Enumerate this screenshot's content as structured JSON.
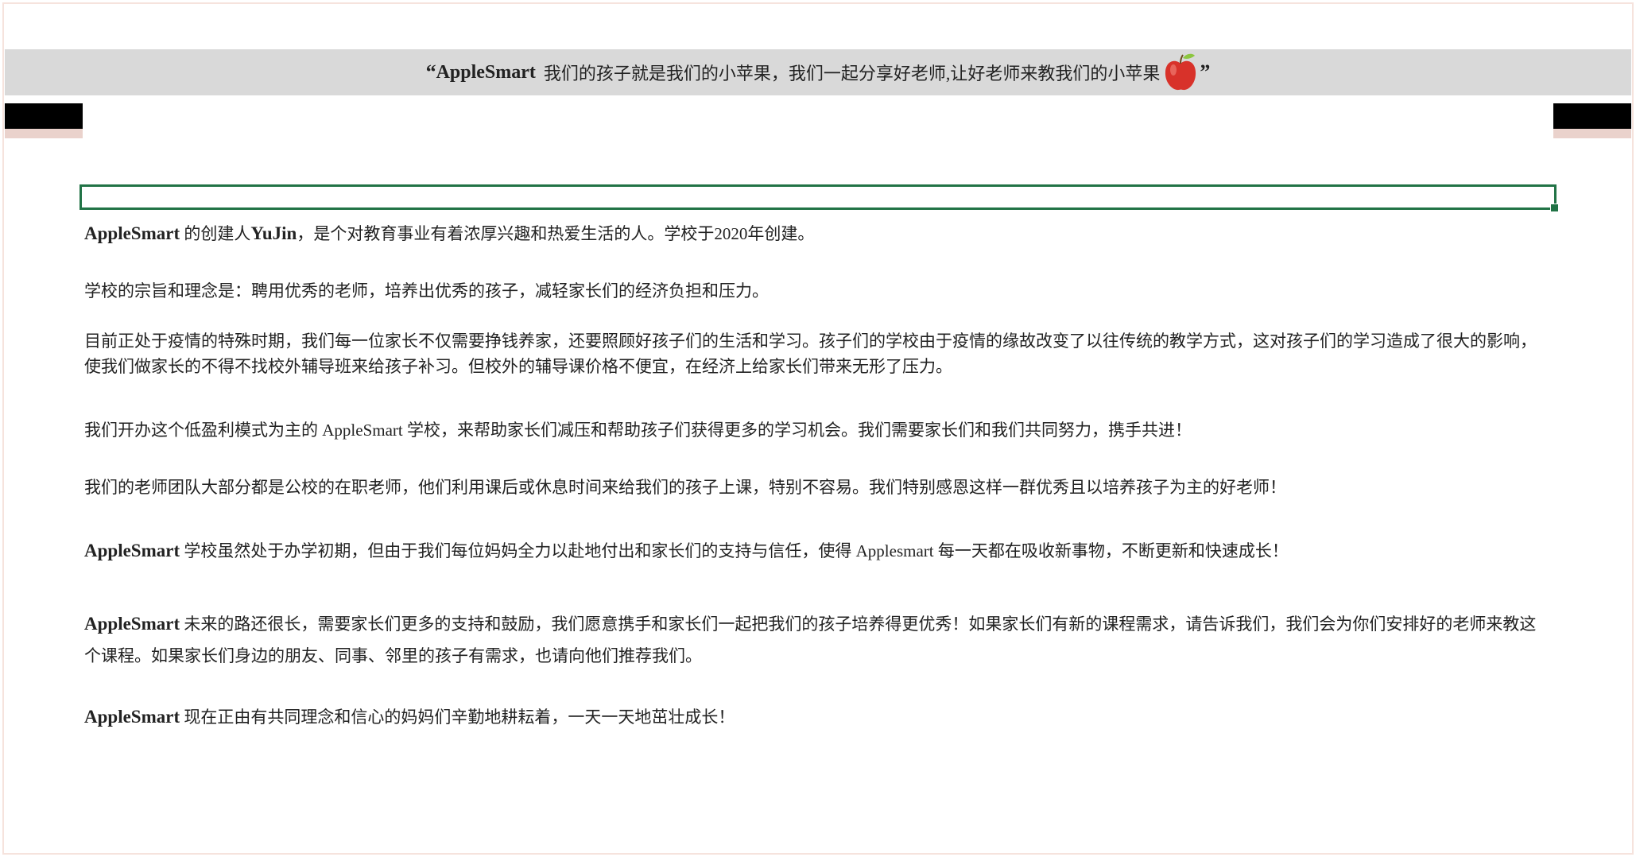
{
  "banner": {
    "open_quote": "“",
    "brand": "AppleSmart",
    "slogan": "我们的孩子就是我们的小苹果，我们一起分享好老师,让好老师来教我们的小苹果",
    "close_quote": "”",
    "icon": "apple-icon"
  },
  "colors": {
    "banner_bg": "#d9d9d9",
    "selection_border": "#217346",
    "corner_block": "#000000",
    "corner_accent": "#ead2cc"
  },
  "paragraphs": [
    {
      "bold": "AppleSmart",
      "text": " 的创建人",
      "bold2": "YuJin",
      "text2": "，是个对教育事业有着浓厚兴趣和热爱生活的人。学校于2020年创建。"
    },
    {
      "text": "学校的宗旨和理念是：聘用优秀的老师，培养出优秀的孩子，减轻家长们的经济负担和压力。"
    },
    {
      "text": "目前正处于疫情的特殊时期，我们每一位家长不仅需要挣钱养家，还要照顾好孩子们的生活和学习。孩子们的学校由于疫情的缘故改变了以往传统的教学方式，这对孩子们的学习造成了很大的影响，使我们做家长的不得不找校外辅导班来给孩子补习。但校外的辅导课价格不便宜，在经济上给家长们带来无形了压力。"
    },
    {
      "text": "我们开办这个低盈利模式为主的 AppleSmart 学校，来帮助家长们减压和帮助孩子们获得更多的学习机会。我们需要家长们和我们共同努力，携手共进！"
    },
    {
      "text": "我们的老师团队大部分都是公校的在职老师，他们利用课后或休息时间来给我们的孩子上课，特别不容易。我们特别感恩这样一群优秀且以培养孩子为主的好老师！"
    },
    {
      "bold": "AppleSmart",
      "text": " 学校虽然处于办学初期，但由于我们每位妈妈全力以赴地付出和家长们的支持与信任，使得 Applesmart 每一天都在吸收新事物，不断更新和快速成长！"
    },
    {
      "bold": "AppleSmart",
      "text": " 未来的路还很长，需要家长们更多的支持和鼓励，我们愿意携手和家长们一起把我们的孩子培养得更优秀！如果家长们有新的课程需求，请告诉我们，我们会为你们安排好的老师来教这个课程。如果家长们身边的朋友、同事、邻里的孩子有需求，也请向他们推荐我们。"
    },
    {
      "bold": "AppleSmart",
      "text": " 现在正由有共同理念和信心的妈妈们辛勤地耕耘着，一天一天地茁壮成长！"
    }
  ]
}
